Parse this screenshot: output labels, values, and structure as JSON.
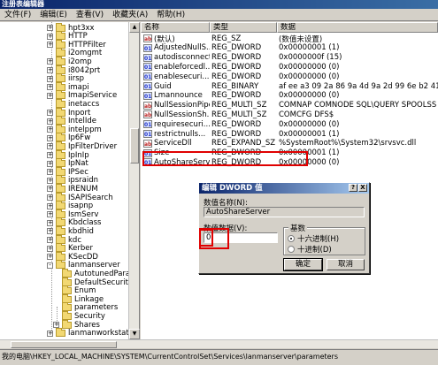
{
  "window": {
    "title": "注册表编辑器"
  },
  "menu": [
    "文件(F)",
    "编辑(E)",
    "查看(V)",
    "收藏夹(A)",
    "帮助(H)"
  ],
  "tree": {
    "items": [
      {
        "label": "hpt3xx",
        "expander": "+",
        "level": 0
      },
      {
        "label": "HTTP",
        "expander": "+",
        "level": 0
      },
      {
        "label": "HTTPFilter",
        "expander": "+",
        "level": 0
      },
      {
        "label": "i2omgmt",
        "expander": "",
        "level": 0
      },
      {
        "label": "i2omp",
        "expander": "+",
        "level": 0
      },
      {
        "label": "i8042prt",
        "expander": "+",
        "level": 0
      },
      {
        "label": "iirsp",
        "expander": "+",
        "level": 0
      },
      {
        "label": "imapi",
        "expander": "+",
        "level": 0
      },
      {
        "label": "ImapiService",
        "expander": "+",
        "level": 0
      },
      {
        "label": "inetaccs",
        "expander": "",
        "level": 0
      },
      {
        "label": "Inport",
        "expander": "+",
        "level": 0
      },
      {
        "label": "IntelIde",
        "expander": "+",
        "level": 0
      },
      {
        "label": "intelppm",
        "expander": "+",
        "level": 0
      },
      {
        "label": "Ip6Fw",
        "expander": "+",
        "level": 0
      },
      {
        "label": "IpFilterDriver",
        "expander": "+",
        "level": 0
      },
      {
        "label": "IpInIp",
        "expander": "+",
        "level": 0
      },
      {
        "label": "IpNat",
        "expander": "+",
        "level": 0
      },
      {
        "label": "IPSec",
        "expander": "+",
        "level": 0
      },
      {
        "label": "ipsraidn",
        "expander": "+",
        "level": 0
      },
      {
        "label": "IRENUM",
        "expander": "+",
        "level": 0
      },
      {
        "label": "ISAPISearch",
        "expander": "+",
        "level": 0
      },
      {
        "label": "isapnp",
        "expander": "+",
        "level": 0
      },
      {
        "label": "IsmServ",
        "expander": "+",
        "level": 0
      },
      {
        "label": "Kbdclass",
        "expander": "+",
        "level": 0
      },
      {
        "label": "kbdhid",
        "expander": "+",
        "level": 0
      },
      {
        "label": "kdc",
        "expander": "+",
        "level": 0
      },
      {
        "label": "Kerber",
        "expander": "+",
        "level": 0
      },
      {
        "label": "KSecDD",
        "expander": "+",
        "level": 0
      },
      {
        "label": "lanmanserver",
        "expander": "-",
        "level": 0
      },
      {
        "label": "AutotunedParamet",
        "expander": "",
        "level": 1
      },
      {
        "label": "DefaultSecurity",
        "expander": "",
        "level": 1
      },
      {
        "label": "Enum",
        "expander": "",
        "level": 1
      },
      {
        "label": "Linkage",
        "expander": "",
        "level": 1
      },
      {
        "label": "parameters",
        "expander": "",
        "level": 1
      },
      {
        "label": "Security",
        "expander": "",
        "level": 1
      },
      {
        "label": "Shares",
        "expander": "+",
        "level": 1
      },
      {
        "label": "lanmanworkstation",
        "expander": "+",
        "level": 0
      }
    ]
  },
  "list": {
    "columns": [
      "名称",
      "类型",
      "数据"
    ],
    "rows": [
      {
        "icon": "ab",
        "name": "(默认)",
        "type": "REG_SZ",
        "data": "(数值未设置)"
      },
      {
        "icon": "bin",
        "name": "AdjustedNullS...",
        "type": "REG_DWORD",
        "data": "0x00000001 (1)"
      },
      {
        "icon": "bin",
        "name": "autodisconnect",
        "type": "REG_DWORD",
        "data": "0x0000000f (15)"
      },
      {
        "icon": "bin",
        "name": "enableforcedl...",
        "type": "REG_DWORD",
        "data": "0x00000000 (0)"
      },
      {
        "icon": "bin",
        "name": "enablesecuri...",
        "type": "REG_DWORD",
        "data": "0x00000000 (0)"
      },
      {
        "icon": "bin",
        "name": "Guid",
        "type": "REG_BINARY",
        "data": "af ee a3 09 2a 86 9a 4d 9a 2d 99 6e b2 41 8..."
      },
      {
        "icon": "bin",
        "name": "Lmannounce",
        "type": "REG_DWORD",
        "data": "0x00000000 (0)"
      },
      {
        "icon": "ab",
        "name": "NullSessionPipes",
        "type": "REG_MULTI_SZ",
        "data": "COMNAP COMNODE SQL\\QUERY SPOOLSS NETLOGON L..."
      },
      {
        "icon": "ab",
        "name": "NullSessionSh...",
        "type": "REG_MULTI_SZ",
        "data": "COMCFG DFS$"
      },
      {
        "icon": "bin",
        "name": "requiresecuri...",
        "type": "REG_DWORD",
        "data": "0x00000000 (0)"
      },
      {
        "icon": "bin",
        "name": "restrictnulls...",
        "type": "REG_DWORD",
        "data": "0x00000001 (1)"
      },
      {
        "icon": "ab",
        "name": "ServiceDll",
        "type": "REG_EXPAND_SZ",
        "data": "%SystemRoot%\\System32\\srvsvc.dll"
      },
      {
        "icon": "bin",
        "name": "Size",
        "type": "REG_DWORD",
        "data": "0x00000001 (1)"
      },
      {
        "icon": "bin",
        "name": "AutoShareServer",
        "type": "REG_DWORD",
        "data": "0x00000000 (0)"
      }
    ]
  },
  "dialog": {
    "title": "编辑 DWORD 值",
    "help_btn": "?",
    "close_btn": "X",
    "name_label": "数值名称(N):",
    "name_value": "AutoShareServer",
    "data_label": "数值数据(V):",
    "data_value": "0",
    "base_title": "基数",
    "radio_hex": "十六进制(H)",
    "radio_dec": "十进制(D)",
    "base_selected": "hex",
    "ok": "确定",
    "cancel": "取消"
  },
  "statusbar": {
    "path": "我的电脑\\HKEY_LOCAL_MACHINE\\SYSTEM\\CurrentControlSet\\Services\\lanmanserver\\parameters"
  },
  "colors": {
    "highlight": "#e00000",
    "title_bar": "#0a246a",
    "selection": "#0a246a"
  },
  "icons": {
    "string_value": "ab-icon",
    "binary_value": "binary-value-icon",
    "folder": "folder-icon"
  }
}
